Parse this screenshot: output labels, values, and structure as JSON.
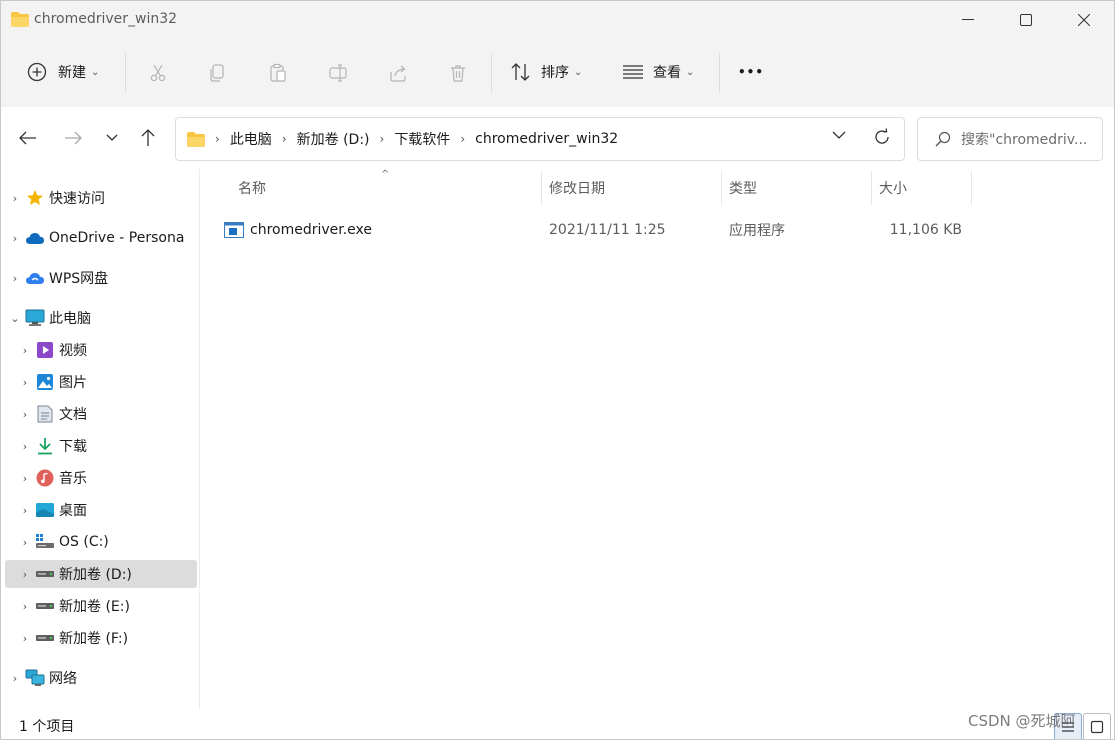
{
  "window": {
    "title": "chromedriver_win32"
  },
  "toolbar": {
    "new_label": "新建",
    "sort_label": "排序",
    "view_label": "查看",
    "more_label": "•••"
  },
  "address": {
    "breadcrumbs": [
      "此电脑",
      "下载软件",
      "chromedriver_win32"
    ],
    "volume": "新加卷 (D:)"
  },
  "search": {
    "placeholder": "搜索\"chromedriv..."
  },
  "sidebar": {
    "items": [
      {
        "label": "快速访问",
        "icon": "star-icon"
      },
      {
        "label": "OneDrive - Persona",
        "icon": "cloud-icon"
      },
      {
        "label": "WPS网盘",
        "icon": "wps-cloud-icon"
      },
      {
        "label": "此电脑",
        "icon": "computer-icon"
      },
      {
        "label": "视频",
        "icon": "video-icon"
      },
      {
        "label": "图片",
        "icon": "picture-icon"
      },
      {
        "label": "文档",
        "icon": "document-icon"
      },
      {
        "label": "下载",
        "icon": "download-icon"
      },
      {
        "label": "音乐",
        "icon": "music-icon"
      },
      {
        "label": "桌面",
        "icon": "desktop-icon"
      },
      {
        "label": "OS (C:)",
        "icon": "windows-drive-icon"
      },
      {
        "label": "新加卷 (D:)",
        "icon": "drive-icon"
      },
      {
        "label": "新加卷 (E:)",
        "icon": "drive-icon"
      },
      {
        "label": "新加卷 (F:)",
        "icon": "drive-icon"
      },
      {
        "label": "网络",
        "icon": "network-icon"
      }
    ]
  },
  "columns": {
    "name": "名称",
    "modified": "修改日期",
    "type": "类型",
    "size": "大小"
  },
  "files": [
    {
      "name": "chromedriver.exe",
      "modified": "2021/11/11 1:25",
      "type": "应用程序",
      "size": "11,106 KB",
      "icon": "exe-icon"
    }
  ],
  "status": {
    "count": "1 个项目"
  },
  "watermark": "CSDN @死城阿",
  "colors": {
    "folder": "#f8c640",
    "accent": "#0067c0",
    "selected": "#dcdcdc"
  }
}
